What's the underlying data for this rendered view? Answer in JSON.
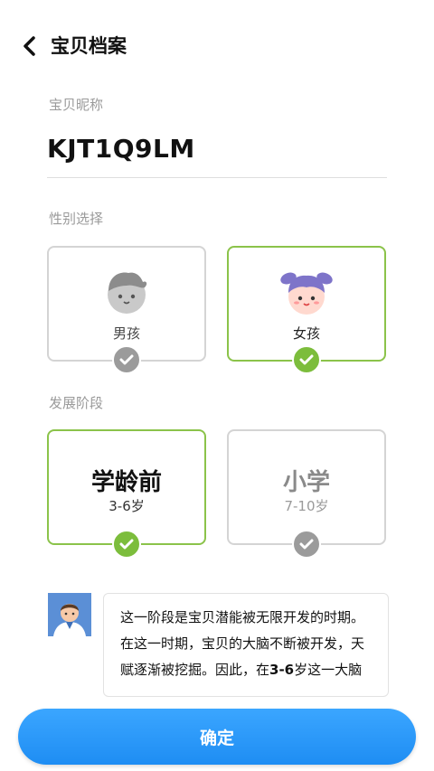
{
  "header": {
    "title": "宝贝档案",
    "back_icon": "chevron-left-icon"
  },
  "nickname": {
    "label": "宝贝昵称",
    "value": "KJT1Q9LM"
  },
  "gender": {
    "label": "性别选择",
    "options": [
      {
        "label": "男孩",
        "selected": false,
        "icon": "boy-avatar-icon"
      },
      {
        "label": "女孩",
        "selected": true,
        "icon": "girl-avatar-icon"
      }
    ]
  },
  "stage": {
    "label": "发展阶段",
    "options": [
      {
        "name": "学龄前",
        "range": "3-6岁",
        "selected": true
      },
      {
        "name": "小学",
        "range": "7-10岁",
        "selected": false
      }
    ]
  },
  "tip": {
    "avatar_icon": "doctor-avatar-icon",
    "line1": "这一阶段是宝贝潜能被无限开发的时期。",
    "line2": "在这一时期，宝贝的大脑不断被开发，天",
    "line3_prefix": "赋逐渐被挖掘。因此，在",
    "line3_bold": "3-6",
    "line3_suffix": "岁这一大脑"
  },
  "confirm": {
    "label": "确定"
  },
  "colors": {
    "accent_green": "#7cbd3c",
    "selected_border": "#8bc34a",
    "button_blue": "#1e8df3"
  }
}
